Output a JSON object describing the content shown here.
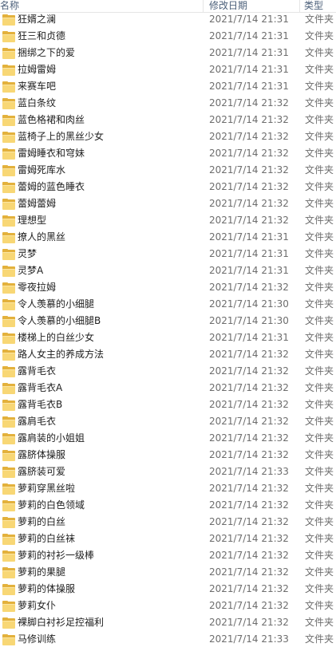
{
  "columns": {
    "name": "名称",
    "date": "修改日期",
    "type": "类型"
  },
  "icon": "folder-icon",
  "colors": {
    "folder_back": "#e3b13c",
    "folder_front": "#f8d775",
    "header_text": "#4c607a"
  },
  "rows": [
    {
      "name": "狂婿之澜",
      "date": "2021/7/14 21:31",
      "type": "文件夹"
    },
    {
      "name": "狂三和贞德",
      "date": "2021/7/14 21:31",
      "type": "文件夹"
    },
    {
      "name": "捆绑之下的爱",
      "date": "2021/7/14 21:31",
      "type": "文件夹"
    },
    {
      "name": "拉姆雷姆",
      "date": "2021/7/14 21:31",
      "type": "文件夹"
    },
    {
      "name": "来赛车吧",
      "date": "2021/7/14 21:31",
      "type": "文件夹"
    },
    {
      "name": "蓝白条纹",
      "date": "2021/7/14 21:32",
      "type": "文件夹"
    },
    {
      "name": "蓝色格裙和肉丝",
      "date": "2021/7/14 21:32",
      "type": "文件夹"
    },
    {
      "name": "蓝椅子上的黑丝少女",
      "date": "2021/7/14 21:32",
      "type": "文件夹"
    },
    {
      "name": "雷姆睡衣和穹妹",
      "date": "2021/7/14 21:32",
      "type": "文件夹"
    },
    {
      "name": "雷姆死库水",
      "date": "2021/7/14 21:32",
      "type": "文件夹"
    },
    {
      "name": "蕾姆的蓝色睡衣",
      "date": "2021/7/14 21:32",
      "type": "文件夹"
    },
    {
      "name": "蕾姆蕾姆",
      "date": "2021/7/14 21:32",
      "type": "文件夹"
    },
    {
      "name": "理想型",
      "date": "2021/7/14 21:32",
      "type": "文件夹"
    },
    {
      "name": "撩人的黑丝",
      "date": "2021/7/14 21:31",
      "type": "文件夹"
    },
    {
      "name": "灵梦",
      "date": "2021/7/14 21:31",
      "type": "文件夹"
    },
    {
      "name": "灵梦A",
      "date": "2021/7/14 21:31",
      "type": "文件夹"
    },
    {
      "name": "零夜拉姆",
      "date": "2021/7/14 21:32",
      "type": "文件夹"
    },
    {
      "name": "令人羡慕的小细腿",
      "date": "2021/7/14 21:30",
      "type": "文件夹"
    },
    {
      "name": "令人羡慕的小细腿B",
      "date": "2021/7/14 21:30",
      "type": "文件夹"
    },
    {
      "name": "楼梯上的白丝少女",
      "date": "2021/7/14 21:31",
      "type": "文件夹"
    },
    {
      "name": "路人女主的养成方法",
      "date": "2021/7/14 21:32",
      "type": "文件夹"
    },
    {
      "name": "露背毛衣",
      "date": "2021/7/14 21:32",
      "type": "文件夹"
    },
    {
      "name": "露背毛衣A",
      "date": "2021/7/14 21:32",
      "type": "文件夹"
    },
    {
      "name": "露背毛衣B",
      "date": "2021/7/14 21:32",
      "type": "文件夹"
    },
    {
      "name": "露肩毛衣",
      "date": "2021/7/14 21:32",
      "type": "文件夹"
    },
    {
      "name": "露肩装的小姐姐",
      "date": "2021/7/14 21:32",
      "type": "文件夹"
    },
    {
      "name": "露脐体操服",
      "date": "2021/7/14 21:32",
      "type": "文件夹"
    },
    {
      "name": "露脐装可爱",
      "date": "2021/7/14 21:33",
      "type": "文件夹"
    },
    {
      "name": "萝莉穿黑丝啦",
      "date": "2021/7/14 21:32",
      "type": "文件夹"
    },
    {
      "name": "萝莉的白色领域",
      "date": "2021/7/14 21:32",
      "type": "文件夹"
    },
    {
      "name": "萝莉的白丝",
      "date": "2021/7/14 21:32",
      "type": "文件夹"
    },
    {
      "name": "萝莉的白丝袜",
      "date": "2021/7/14 21:32",
      "type": "文件夹"
    },
    {
      "name": "萝莉的衬衫一级棒",
      "date": "2021/7/14 21:32",
      "type": "文件夹"
    },
    {
      "name": "萝莉的果腿",
      "date": "2021/7/14 21:32",
      "type": "文件夹"
    },
    {
      "name": "萝莉的体操服",
      "date": "2021/7/14 21:32",
      "type": "文件夹"
    },
    {
      "name": "萝莉女仆",
      "date": "2021/7/14 21:32",
      "type": "文件夹"
    },
    {
      "name": "裸脚白衬衫足控福利",
      "date": "2021/7/14 21:32",
      "type": "文件夹"
    },
    {
      "name": "马修训练",
      "date": "2021/7/14 21:33",
      "type": "文件夹"
    }
  ]
}
